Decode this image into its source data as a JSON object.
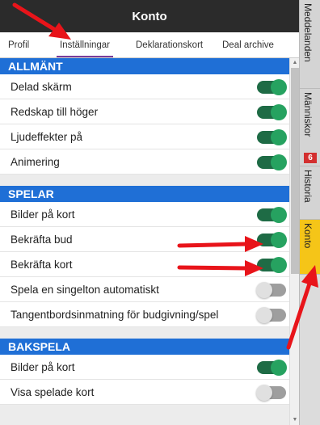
{
  "header": {
    "title": "Konto"
  },
  "tabs": [
    {
      "label": "Profil"
    },
    {
      "label": "Inställningar"
    },
    {
      "label": "Deklarationskort"
    },
    {
      "label": "Deal archive"
    }
  ],
  "sections": [
    {
      "title": "ALLMÄNT",
      "rows": [
        {
          "label": "Delad skärm",
          "state": "on"
        },
        {
          "label": "Redskap till höger",
          "state": "on"
        },
        {
          "label": "Ljudeffekter på",
          "state": "on"
        },
        {
          "label": "Animering",
          "state": "on"
        }
      ]
    },
    {
      "title": "SPELAR",
      "rows": [
        {
          "label": "Bilder på kort",
          "state": "on"
        },
        {
          "label": "Bekräfta bud",
          "state": "on"
        },
        {
          "label": "Bekräfta kort",
          "state": "on"
        },
        {
          "label": "Spela en singelton automatiskt",
          "state": "off"
        },
        {
          "label": "Tangentbordsinmatning för budgivning/spel",
          "state": "off"
        }
      ]
    },
    {
      "title": "BAKSPELA",
      "rows": [
        {
          "label": "Bilder på kort",
          "state": "on"
        },
        {
          "label": "Visa spelade kort",
          "state": "off"
        }
      ]
    }
  ],
  "side_tabs": [
    {
      "label": "Meddelanden"
    },
    {
      "label": "Människor",
      "badge": "6"
    },
    {
      "label": "Historia"
    },
    {
      "label": "Konto"
    }
  ],
  "colors": {
    "section_header": "#1f6fd6",
    "toggle_on": "#26a260",
    "toggle_off": "#e0e0e0",
    "active_side_tab": "#f5c518",
    "annotation_arrow": "#e8141a"
  }
}
